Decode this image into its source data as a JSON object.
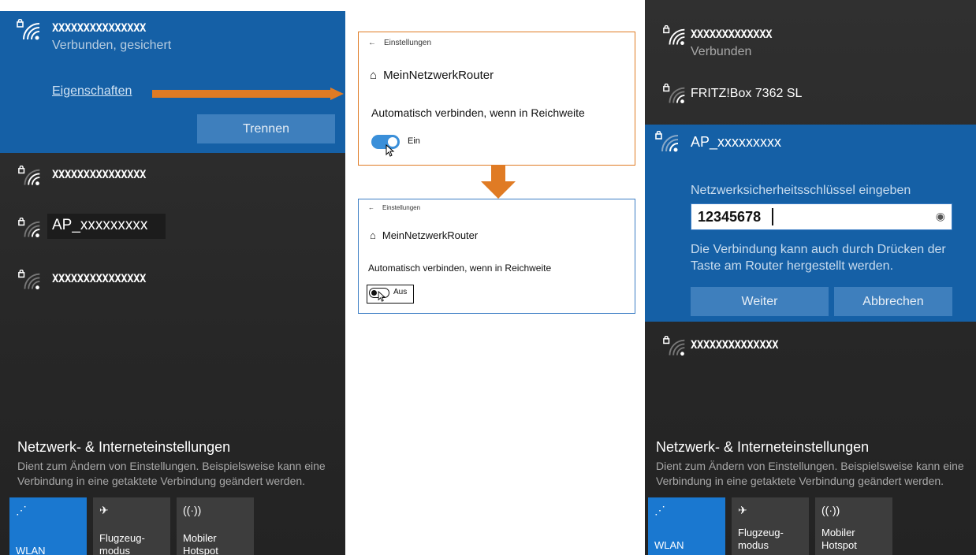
{
  "left": {
    "connected": {
      "name": "XXXXXXXXXXXXXXX",
      "status": "Verbunden, gesichert",
      "properties": "Eigenschaften",
      "disconnect": "Trennen"
    },
    "networks": [
      {
        "name": "XXXXXXXXXXXXXXX"
      },
      {
        "name": "AP_xxxxxxxxx"
      },
      {
        "name": "XXXXXXXXXXXXXXX"
      }
    ],
    "settings": {
      "title": "Netzwerk- & Interneteinstellungen",
      "desc1": "Dient zum Ändern von Einstellungen. Beispielsweise kann eine",
      "desc2": "Verbindung in eine getaktete Verbindung geändert werden."
    },
    "tiles": [
      {
        "label": "WLAN"
      },
      {
        "label1": "Flugzeug-",
        "label2": "modus"
      },
      {
        "label1": "Mobiler",
        "label2": "Hotspot"
      }
    ]
  },
  "card_top": {
    "back": "Einstellungen",
    "router": "MeinNetzwerkRouter",
    "auto": "Automatisch verbinden, wenn in Reichweite",
    "toggle_label": "Ein"
  },
  "card_bottom": {
    "back": "Einstellungen",
    "router": "MeinNetzwerkRouter",
    "auto": "Automatisch verbinden, wenn in Reichweite",
    "toggle_label": "Aus"
  },
  "right": {
    "networks_top": [
      {
        "name": "XXXXXXXXXXXXX",
        "status": "Verbunden"
      },
      {
        "name": "FRITZ!Box 7362 SL"
      }
    ],
    "selected": {
      "name": "AP_xxxxxxxxx",
      "prompt": "Netzwerksicherheitsschlüssel eingeben",
      "password": "12345678",
      "hint1": "Die Verbindung kann auch durch Drücken der",
      "hint2": "Taste am Router hergestellt werden.",
      "next": "Weiter",
      "cancel": "Abbrechen"
    },
    "networks_bottom": [
      {
        "name": "XXXXXXXXXXXXXX"
      }
    ],
    "settings": {
      "title": "Netzwerk- & Interneteinstellungen",
      "desc1": "Dient zum Ändern von Einstellungen. Beispielsweise kann eine",
      "desc2": "Verbindung in eine getaktete Verbindung geändert werden."
    },
    "tiles": [
      {
        "label": "WLAN"
      },
      {
        "label1": "Flugzeug-",
        "label2": "modus"
      },
      {
        "label1": "Mobiler",
        "label2": "Hotspot"
      }
    ]
  },
  "colors": {
    "accent": "#1560a6",
    "arrow": "#e07b24",
    "toggle_on": "#3a8fd9"
  }
}
